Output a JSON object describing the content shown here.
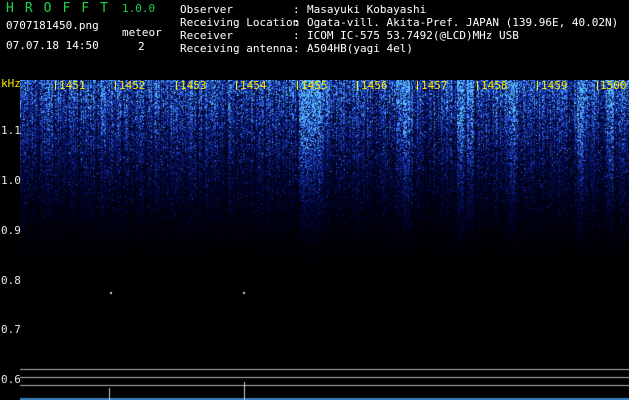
{
  "header": {
    "app_title": "HROFFT",
    "app_version": "1.0.0",
    "filename": "0707181450.png",
    "timestamp": "07.07.18 14:50",
    "meteor_label": "meteor",
    "meteor_count": "2"
  },
  "info": [
    {
      "label": "Observer",
      "sep": ":",
      "value": "Masayuki Kobayashi"
    },
    {
      "label": "Receiving Location",
      "sep": ":",
      "value": "Ogata-vill. Akita-Pref. JAPAN (139.96E, 40.02N)"
    },
    {
      "label": "Receiver",
      "sep": ":",
      "value": "ICOM IC-575 53.7492(@LCD)MHz USB"
    },
    {
      "label": "Receiving antenna",
      "sep": ":",
      "value": "A504HB(yagi 4el)"
    }
  ],
  "spectrogram": {
    "freq_unit": "kHz",
    "time_labels": [
      "1451",
      "1452",
      "1453",
      "1454",
      "1455",
      "1456",
      "1457",
      "1458",
      "1459",
      "1500"
    ],
    "freq_labels": [
      "1.1",
      "1.0",
      "0.9",
      "0.8",
      "0.7",
      "0.6"
    ],
    "colors": {
      "signal": "#3050ff",
      "highlight": "#c8d8ff",
      "axis_time": "#ffe600",
      "title": "#19d64a"
    }
  }
}
